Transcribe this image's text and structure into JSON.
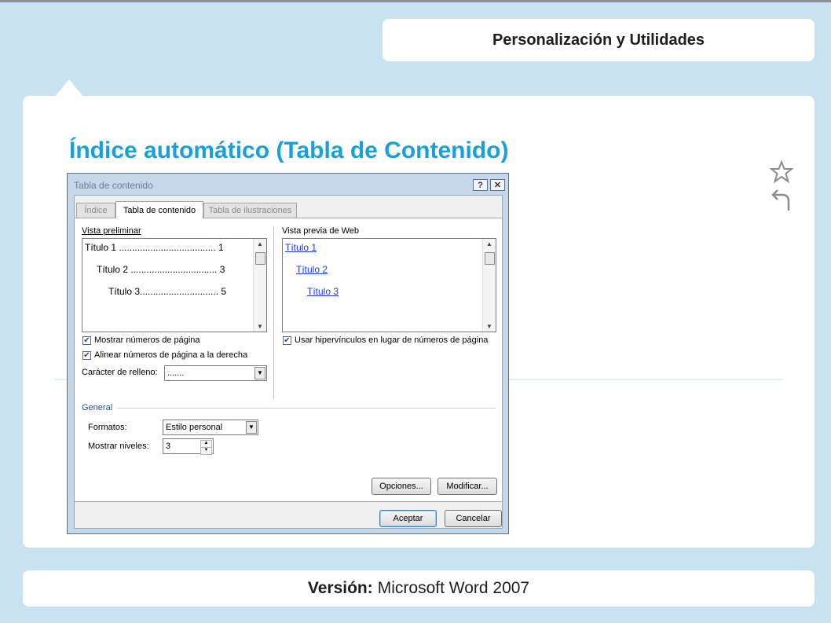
{
  "header": {
    "title": "Personalización y Utilidades"
  },
  "slide": {
    "title": "Índice automático (Tabla de Contenido)"
  },
  "footer": {
    "label": "Versión:",
    "value": "Microsoft Word 2007"
  },
  "icons": {
    "favorite": "star-icon",
    "back": "return-arrow-icon"
  },
  "dialog": {
    "title": "Tabla de contenido",
    "help_button": "?",
    "close_button": "✕",
    "tabs": [
      {
        "label": "Índice",
        "active": false
      },
      {
        "label": "Tabla de contenido",
        "active": true
      },
      {
        "label": "Tabla de ilustraciones",
        "active": false
      }
    ],
    "print_preview": {
      "label": "Vista preliminar",
      "lines": [
        {
          "text": "Título 1 ..................................... 1"
        },
        {
          "text": "Título 2 ................................. 3"
        },
        {
          "text": "Título 3.............................. 5"
        }
      ]
    },
    "web_preview": {
      "label": "Vista previa de Web",
      "links": [
        "Título 1",
        "Título 2",
        "Título 3"
      ]
    },
    "show_page_numbers": {
      "label": "Mostrar números de página",
      "checked": true
    },
    "right_align": {
      "label": "Alinear números de página a la derecha",
      "checked": true
    },
    "tab_leader": {
      "label": "Carácter de relleno:",
      "value": "......."
    },
    "use_hyperlinks": {
      "label": "Usar hipervínculos en lugar de números de página",
      "checked": true
    },
    "general": {
      "label": "General",
      "formats_label": "Formatos:",
      "formats_value": "Estilo personal",
      "levels_label": "Mostrar niveles:",
      "levels_value": "3"
    },
    "buttons": {
      "options": "Opciones...",
      "modify": "Modificar...",
      "ok": "Aceptar",
      "cancel": "Cancelar"
    }
  },
  "colors": {
    "accent": "#19a0d8",
    "background": "#c8e3ef"
  }
}
